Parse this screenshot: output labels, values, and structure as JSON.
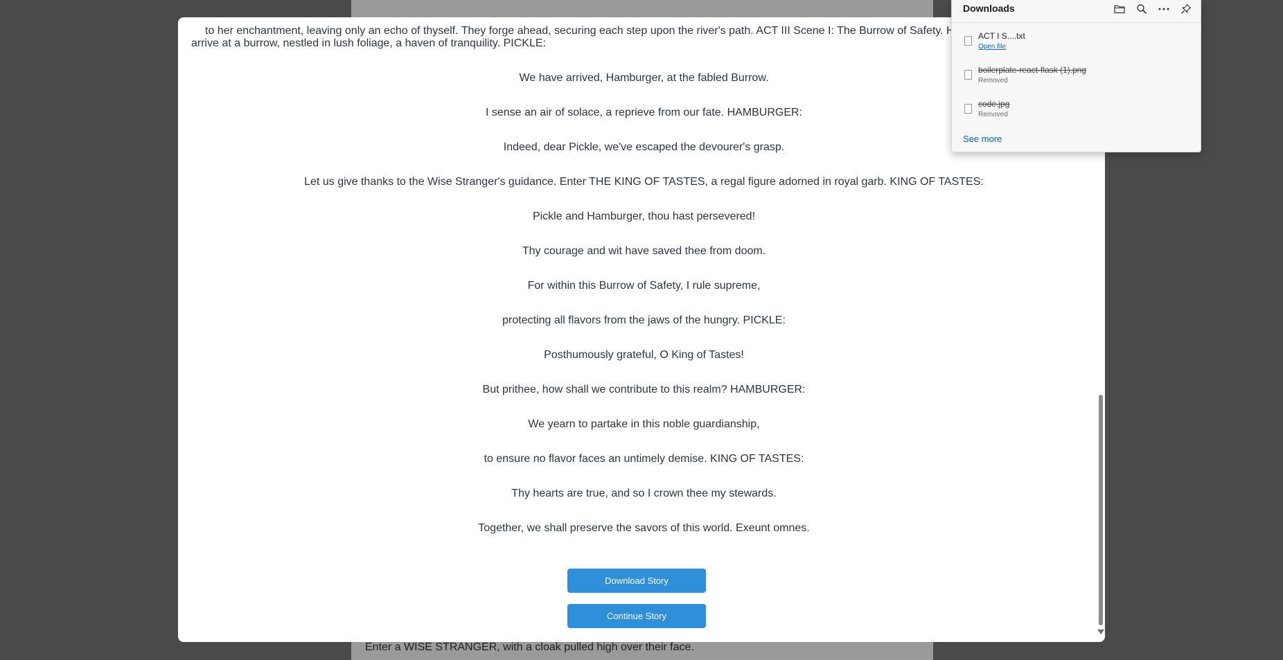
{
  "background_page": {
    "visible_line": "Enter a WISE STRANGER, with a cloak pulled high over their face."
  },
  "story": {
    "intro": "to her enchantment, leaving only an echo of thyself. They forge ahead, securing each step upon the river's path. ACT III Scene I: The Burrow of Safety. HAMBURGER and PICKLE arrive at a burrow, nestled in lush foliage, a haven of tranquility. PICKLE:",
    "verses": [
      "We have arrived, Hamburger, at the fabled Burrow.",
      "I sense an air of solace, a reprieve from our fate. HAMBURGER:",
      "Indeed, dear Pickle, we've escaped the devourer's grasp.",
      "Let us give thanks to the Wise Stranger's guidance. Enter THE KING OF TASTES, a regal figure adorned in royal garb. KING OF TASTES:",
      "Pickle and Hamburger, thou hast persevered!",
      "Thy courage and wit have saved thee from doom.",
      "For within this Burrow of Safety, I rule supreme,",
      "protecting all flavors from the jaws of the hungry. PICKLE:",
      "Posthumously grateful, O King of Tastes!",
      "But prithee, how shall we contribute to this realm? HAMBURGER:",
      "We yearn to partake in this noble guardianship,",
      "to ensure no flavor faces an untimely demise. KING OF TASTES:",
      "Thy hearts are true, and so I crown thee my stewards.",
      "Together, we shall preserve the savors of this world. Exeunt omnes."
    ],
    "download_button": "Download Story",
    "continue_button": "Continue Story"
  },
  "downloads": {
    "title": "Downloads",
    "icons": [
      "folder-icon",
      "search-icon",
      "more-icon",
      "pin-icon"
    ],
    "items": [
      {
        "name": "ACT I S....txt",
        "status": "Open file",
        "removed": false
      },
      {
        "name": "boilerplate-react-flask (1).png",
        "status": "Removed",
        "removed": true
      },
      {
        "name": "code.jpg",
        "status": "Removed",
        "removed": true
      }
    ],
    "see_more": "See more"
  },
  "colors": {
    "button": "#2f8fd9",
    "link": "#0a64c2",
    "overlay": "#4a4a4a"
  }
}
